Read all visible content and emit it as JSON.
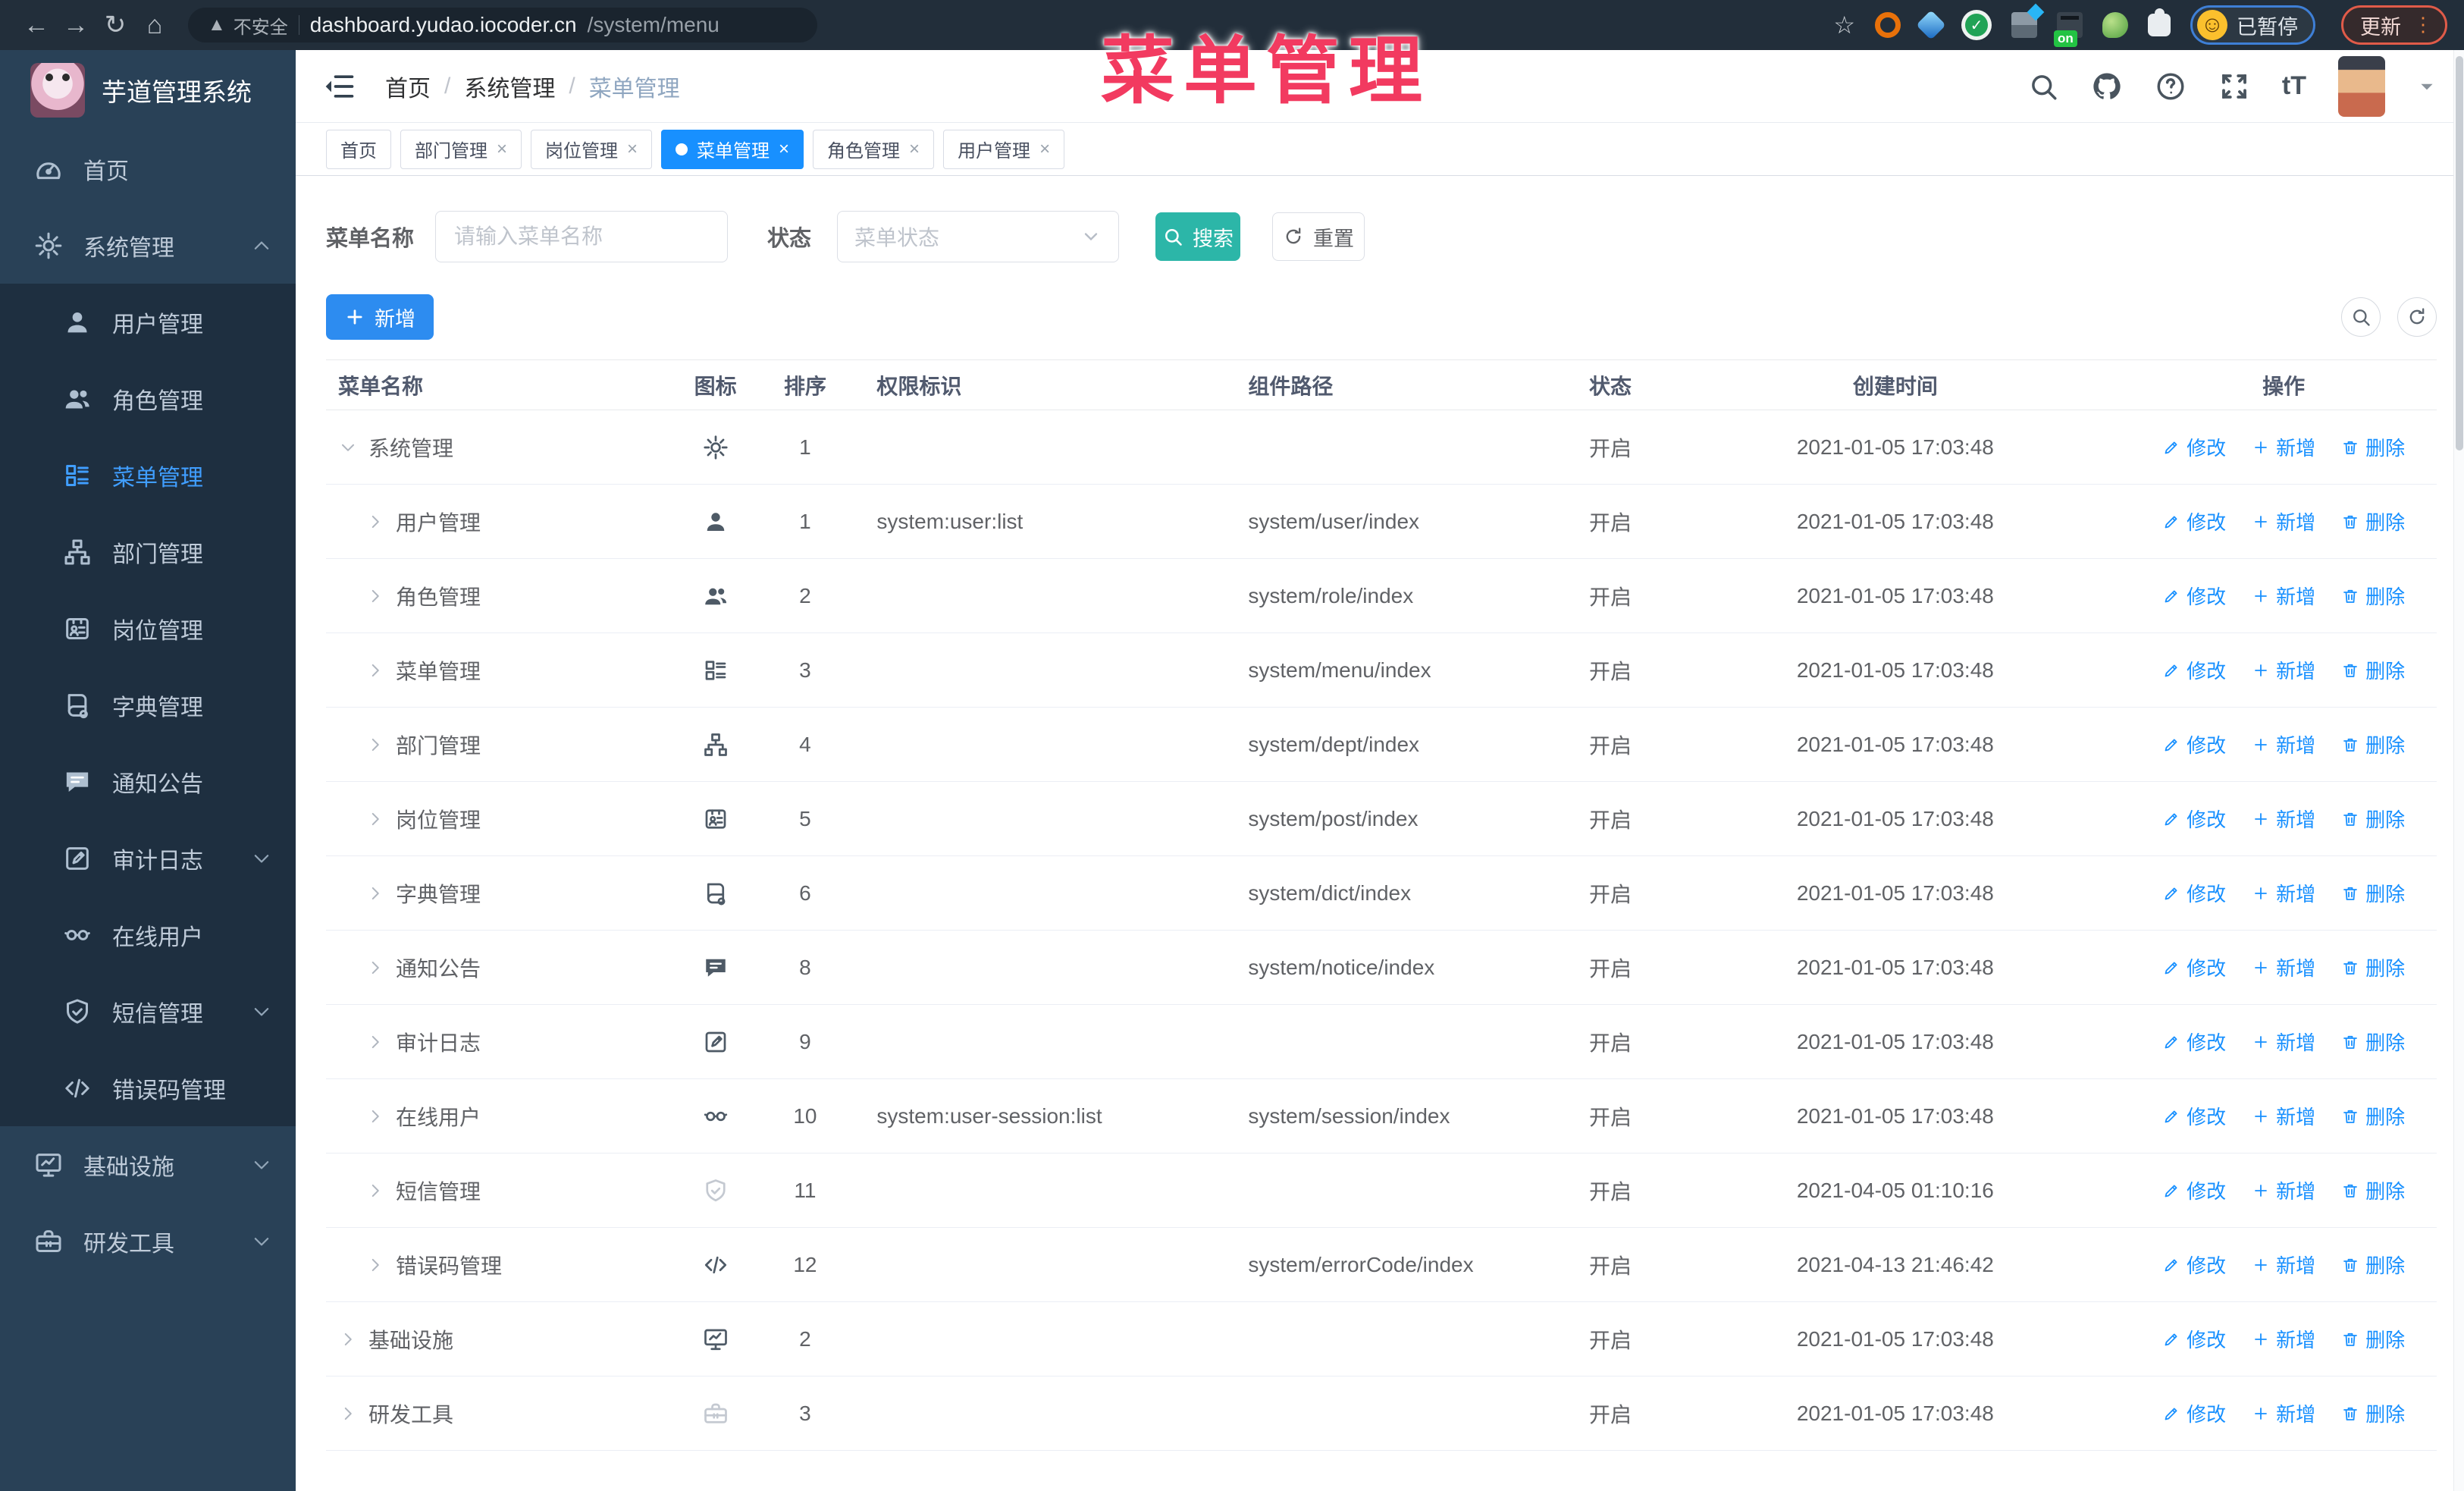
{
  "browser": {
    "security_label": "不安全",
    "url_host": "dashboard.yudao.iocoder.cn",
    "url_path": "/system/menu",
    "extension_on_badge": "on",
    "profile_label": "已暂停",
    "update_label": "更新"
  },
  "annotation": {
    "title": "菜单管理"
  },
  "sidebar": {
    "logo_title": "芋道管理系统",
    "items": [
      {
        "label": "首页",
        "icon": "dashboard",
        "kind": "root"
      },
      {
        "label": "系统管理",
        "icon": "gear",
        "kind": "root",
        "chevron": "up"
      },
      {
        "label": "用户管理",
        "icon": "user",
        "kind": "sub"
      },
      {
        "label": "角色管理",
        "icon": "users",
        "kind": "sub"
      },
      {
        "label": "菜单管理",
        "icon": "menu",
        "kind": "sub",
        "active": true
      },
      {
        "label": "部门管理",
        "icon": "tree",
        "kind": "sub"
      },
      {
        "label": "岗位管理",
        "icon": "badge",
        "kind": "sub"
      },
      {
        "label": "字典管理",
        "icon": "dict",
        "kind": "sub"
      },
      {
        "label": "通知公告",
        "icon": "message",
        "kind": "sub"
      },
      {
        "label": "审计日志",
        "icon": "log",
        "kind": "sub",
        "chevron": "down"
      },
      {
        "label": "在线用户",
        "icon": "online",
        "kind": "sub"
      },
      {
        "label": "短信管理",
        "icon": "shield",
        "kind": "sub",
        "chevron": "down"
      },
      {
        "label": "错误码管理",
        "icon": "code",
        "kind": "sub"
      },
      {
        "label": "基础设施",
        "icon": "monitor",
        "kind": "root",
        "chevron": "down"
      },
      {
        "label": "研发工具",
        "icon": "toolbox",
        "kind": "root",
        "chevron": "down"
      }
    ]
  },
  "header": {
    "breadcrumb": [
      "首页",
      "系统管理",
      "菜单管理"
    ]
  },
  "tabs": [
    {
      "label": "首页",
      "closable": false,
      "active": false
    },
    {
      "label": "部门管理",
      "closable": true,
      "active": false
    },
    {
      "label": "岗位管理",
      "closable": true,
      "active": false
    },
    {
      "label": "菜单管理",
      "closable": true,
      "active": true
    },
    {
      "label": "角色管理",
      "closable": true,
      "active": false
    },
    {
      "label": "用户管理",
      "closable": true,
      "active": false
    }
  ],
  "filters": {
    "name_label": "菜单名称",
    "name_placeholder": "请输入菜单名称",
    "status_label": "状态",
    "status_placeholder": "菜单状态",
    "search_label": "搜索",
    "reset_label": "重置"
  },
  "toolbar": {
    "add_label": "新增"
  },
  "table": {
    "columns": [
      "菜单名称",
      "图标",
      "排序",
      "权限标识",
      "组件路径",
      "状态",
      "创建时间",
      "操作"
    ],
    "action_labels": [
      "修改",
      "新增",
      "删除"
    ],
    "rows": [
      {
        "name": "系统管理",
        "level": 0,
        "chevron": "down",
        "icon": "gear",
        "sort": "1",
        "perm": "",
        "path": "",
        "status": "开启",
        "time": "2021-01-05 17:03:48"
      },
      {
        "name": "用户管理",
        "level": 1,
        "chevron": "right",
        "icon": "user",
        "sort": "1",
        "perm": "system:user:list",
        "path": "system/user/index",
        "status": "开启",
        "time": "2021-01-05 17:03:48"
      },
      {
        "name": "角色管理",
        "level": 1,
        "chevron": "right",
        "icon": "users",
        "sort": "2",
        "perm": "",
        "path": "system/role/index",
        "status": "开启",
        "time": "2021-01-05 17:03:48"
      },
      {
        "name": "菜单管理",
        "level": 1,
        "chevron": "right",
        "icon": "menu",
        "sort": "3",
        "perm": "",
        "path": "system/menu/index",
        "status": "开启",
        "time": "2021-01-05 17:03:48"
      },
      {
        "name": "部门管理",
        "level": 1,
        "chevron": "right",
        "icon": "tree",
        "sort": "4",
        "perm": "",
        "path": "system/dept/index",
        "status": "开启",
        "time": "2021-01-05 17:03:48"
      },
      {
        "name": "岗位管理",
        "level": 1,
        "chevron": "right",
        "icon": "badge",
        "sort": "5",
        "perm": "",
        "path": "system/post/index",
        "status": "开启",
        "time": "2021-01-05 17:03:48"
      },
      {
        "name": "字典管理",
        "level": 1,
        "chevron": "right",
        "icon": "dict",
        "sort": "6",
        "perm": "",
        "path": "system/dict/index",
        "status": "开启",
        "time": "2021-01-05 17:03:48"
      },
      {
        "name": "通知公告",
        "level": 1,
        "chevron": "right",
        "icon": "message",
        "sort": "8",
        "perm": "",
        "path": "system/notice/index",
        "status": "开启",
        "time": "2021-01-05 17:03:48"
      },
      {
        "name": "审计日志",
        "level": 1,
        "chevron": "right",
        "icon": "log",
        "sort": "9",
        "perm": "",
        "path": "",
        "status": "开启",
        "time": "2021-01-05 17:03:48"
      },
      {
        "name": "在线用户",
        "level": 1,
        "chevron": "right",
        "icon": "online",
        "sort": "10",
        "perm": "system:user-session:list",
        "path": "system/session/index",
        "status": "开启",
        "time": "2021-01-05 17:03:48"
      },
      {
        "name": "短信管理",
        "level": 1,
        "chevron": "right",
        "icon": "shield",
        "muted": true,
        "sort": "11",
        "perm": "",
        "path": "",
        "status": "开启",
        "time": "2021-04-05 01:10:16"
      },
      {
        "name": "错误码管理",
        "level": 1,
        "chevron": "right",
        "icon": "code",
        "sort": "12",
        "perm": "",
        "path": "system/errorCode/index",
        "status": "开启",
        "time": "2021-04-13 21:46:42"
      },
      {
        "name": "基础设施",
        "level": 0,
        "chevron": "right",
        "icon": "monitor",
        "sort": "2",
        "perm": "",
        "path": "",
        "status": "开启",
        "time": "2021-01-05 17:03:48"
      },
      {
        "name": "研发工具",
        "level": 0,
        "chevron": "right",
        "icon": "toolbox",
        "muted": true,
        "sort": "3",
        "perm": "",
        "path": "",
        "status": "开启",
        "time": "2021-01-05 17:03:48"
      }
    ]
  },
  "colors": {
    "accent": "#1890ff",
    "search_teal": "#2cb6a8",
    "sidebar": "#294157",
    "sidebar_sub": "#1e2f40",
    "annotation_pink": "#f23a60"
  }
}
